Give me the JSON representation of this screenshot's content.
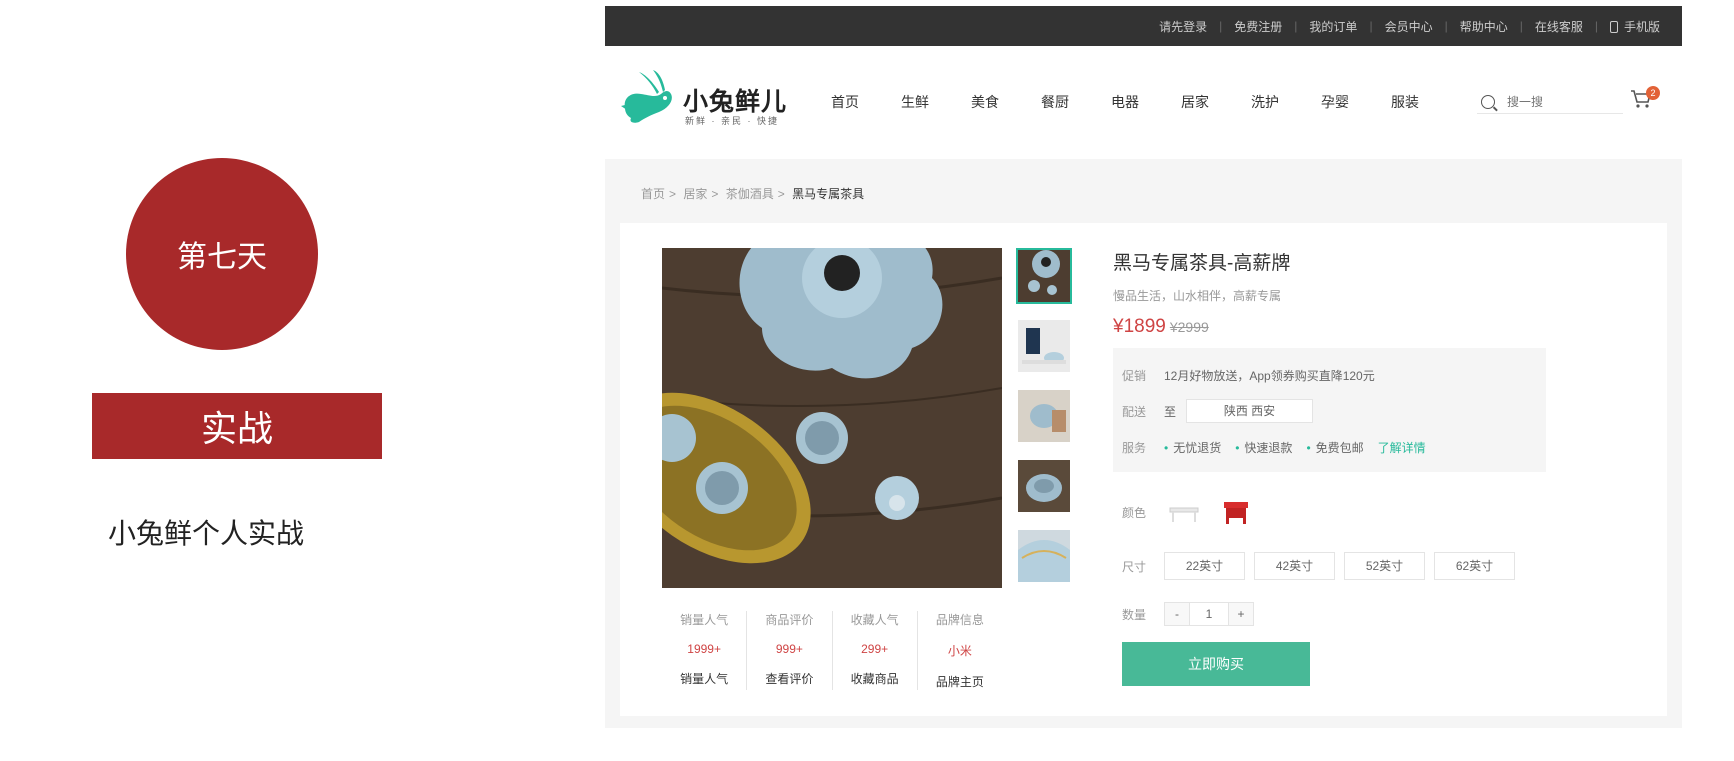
{
  "slide": {
    "day_label": "第七天",
    "tag_label": "实战",
    "subtitle": "小兔鲜个人实战",
    "accent_color": "#a8292a"
  },
  "topbar": {
    "links": [
      "请先登录",
      "免费注册",
      "我的订单",
      "会员中心",
      "帮助中心",
      "在线客服",
      "手机版"
    ]
  },
  "header": {
    "logo_text": "小兔鲜儿",
    "logo_slogan": "新鲜 · 亲民 · 快捷",
    "nav": [
      "首页",
      "生鲜",
      "美食",
      "餐厨",
      "电器",
      "居家",
      "洗护",
      "孕婴",
      "服装"
    ],
    "search_placeholder": "搜一搜",
    "cart_count": "2",
    "brand_color": "#27ba9b"
  },
  "breadcrumb": {
    "items": [
      "首页",
      "居家",
      "茶伽酒具"
    ],
    "current": "黑马专属茶具"
  },
  "product": {
    "title": "黑马专属茶具-高薪牌",
    "desc": "慢品生活，山水相伴，高薪专属",
    "price": "¥1899",
    "old_price": "¥2999",
    "promo_label": "促销",
    "promo_text": "12月好物放送，App领券购买直降120元",
    "delivery_label": "配送",
    "delivery_to": "至",
    "delivery_addr": "陕西 西安",
    "service_label": "服务",
    "services": [
      "无忧退货",
      "快速退款",
      "免费包邮"
    ],
    "service_link": "了解详情",
    "color_label": "颜色",
    "size_label": "尺寸",
    "sizes": [
      "22英寸",
      "42英寸",
      "52英寸",
      "62英寸"
    ],
    "qty_label": "数量",
    "qty_minus": "-",
    "qty_value": "1",
    "qty_plus": "+",
    "buy_label": "立即购买",
    "price_color": "#cf4444",
    "buy_color": "#48b997"
  },
  "stats": [
    {
      "label": "销量人气",
      "value": "1999+",
      "link": "销量人气"
    },
    {
      "label": "商品评价",
      "value": "999+",
      "link": "查看评价"
    },
    {
      "label": "收藏人气",
      "value": "299+",
      "link": "收藏商品"
    },
    {
      "label": "品牌信息",
      "value": "小米",
      "link": "品牌主页"
    }
  ]
}
